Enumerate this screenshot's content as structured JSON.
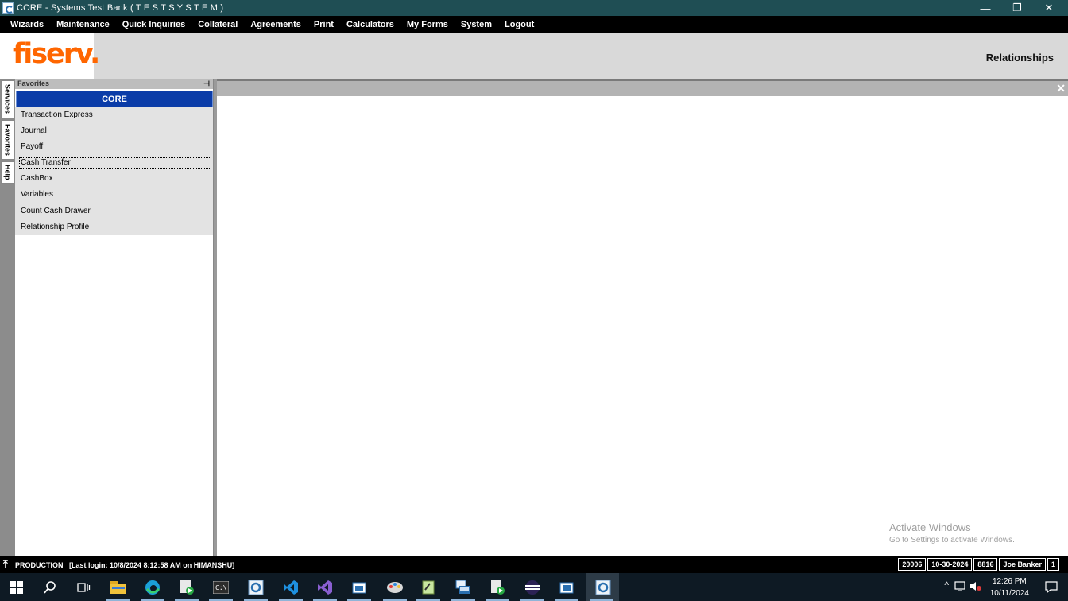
{
  "window": {
    "title": "CORE - Systems Test Bank ( T E S T   S Y S T E M )",
    "minimize": "—",
    "restore": "❐",
    "close": "✕"
  },
  "menu": [
    "Wizards",
    "Maintenance",
    "Quick Inquiries",
    "Collateral",
    "Agreements",
    "Print",
    "Calculators",
    "My Forms",
    "System",
    "Logout"
  ],
  "banner": {
    "logo_text": "fiserv.",
    "context_title": "Relationships"
  },
  "side_tabs": [
    "Services",
    "Favorites",
    "Help"
  ],
  "favorites": {
    "header": "Favorites",
    "pin": "⊣",
    "group": "CORE",
    "items": [
      "Transaction Express",
      "Journal",
      "Payoff",
      "Cash Transfer",
      "CashBox",
      "Variables",
      "Count Cash Drawer",
      "Relationship Profile"
    ],
    "focused_index": 3
  },
  "main": {
    "close": "✕"
  },
  "watermark": {
    "line1": "Activate Windows",
    "line2": "Go to Settings to activate Windows."
  },
  "status": {
    "arrow": "⤒",
    "environment": "PRODUCTION",
    "last_login": "[Last login: 10/8/2024 8:12:58 AM on HIMANSHU]",
    "cells": [
      "20006",
      "10-30-2024",
      "8816",
      "Joe  Banker",
      "1"
    ]
  },
  "taskbar": {
    "apps": [
      "start-icon",
      "search-icon",
      "task-view-icon",
      "file-explorer-icon",
      "edge-icon",
      "media-app-icon",
      "terminal-icon",
      "core-app-icon",
      "vscode-icon",
      "visual-studio-icon",
      "paint-icon",
      "notepad-icon",
      "remote-desktop-icon",
      "media-player-icon",
      "eclipse-icon",
      "store-icon",
      "core-app-active-icon"
    ],
    "tray": {
      "chevron": "^"
    },
    "clock_time": "12:26 PM",
    "clock_date": "10/11/2024"
  },
  "colors": {
    "titlebar": "#1f4e54",
    "menubar": "#000000",
    "banner": "#d9d9d9",
    "brand_orange": "#ff6600",
    "group_blue": "#0b3ca8",
    "taskbar": "#0e1a24"
  }
}
